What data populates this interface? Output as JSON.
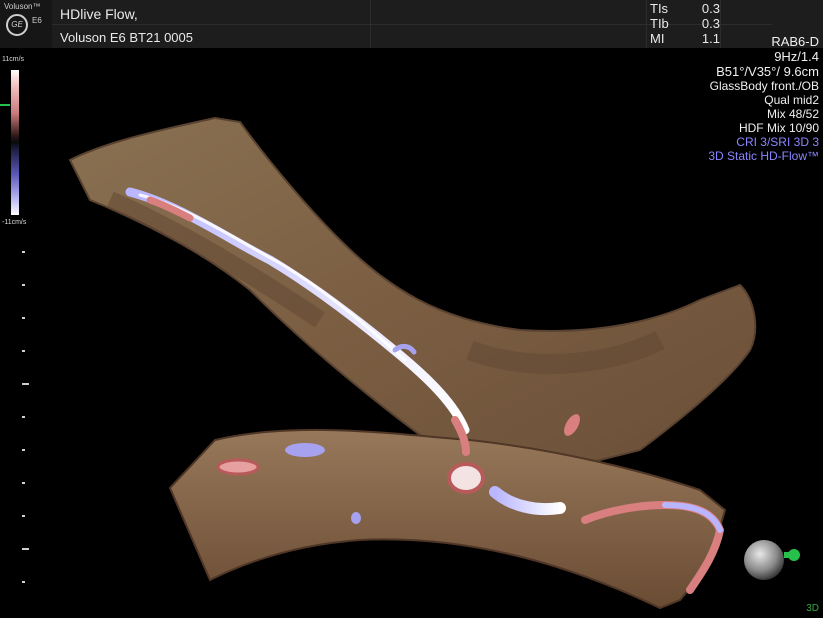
{
  "header": {
    "brand": "Voluson™",
    "logo_text": "GE",
    "model": "E6",
    "line1": "HDlive Flow,",
    "line2": "Voluson E6 BT21 0005"
  },
  "indices": [
    {
      "label": "TIs",
      "value": "0.3"
    },
    {
      "label": "TIb",
      "value": "0.3"
    },
    {
      "label": "MI",
      "value": "1.1"
    }
  ],
  "params": {
    "probe": "RAB6-D",
    "freq": "9Hz/1.4",
    "angles": "B51°/V35°/ 9.6cm",
    "preset": "GlassBody front./OB",
    "quality": "Qual mid2",
    "mix": "Mix 48/52",
    "hdf_mix": "HDF Mix 10/90",
    "cri": "CRI 3/SRI 3D 3",
    "mode": "3D Static HD-Flow™"
  },
  "scale": {
    "top": "11cm/s",
    "bottom": "-11cm/s"
  },
  "mode_badge": "3D",
  "colors": {
    "flow_pos": "#d97f7f",
    "flow_neg": "#8a86ff",
    "tissue": "#8a6a4a",
    "marker": "#26c04a"
  }
}
